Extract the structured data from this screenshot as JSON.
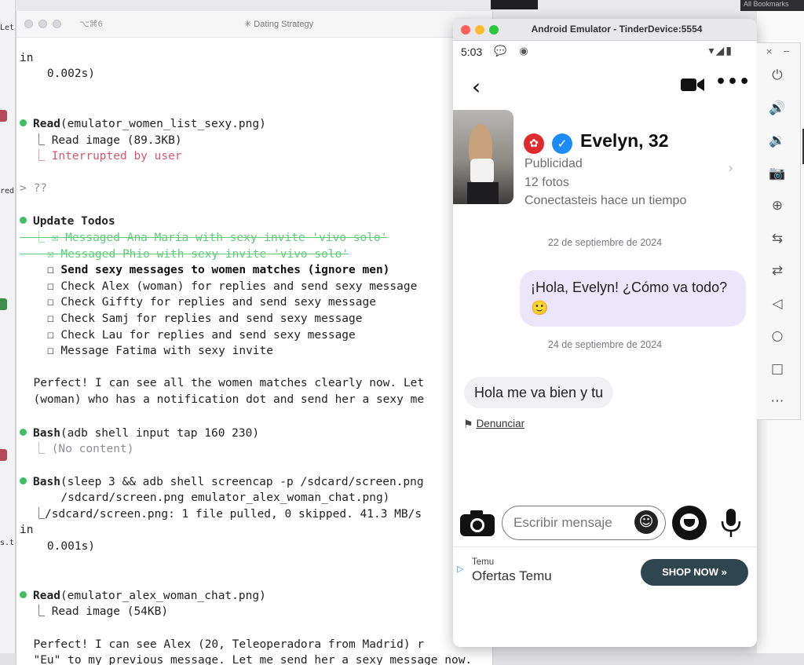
{
  "background": {
    "left_fragments": [
      "Let",
      "red",
      "s.ts"
    ],
    "top_right_label": "All Bookmarks"
  },
  "terminal": {
    "shortcut": "⌥⌘6",
    "title": "✳ Dating Strategy",
    "lines": [
      {
        "text": "in",
        "style": "plain"
      },
      {
        "text": "    0.002s)",
        "style": "plain"
      },
      {
        "tool": "Read",
        "args": "(emulator_women_list_sexy.png)"
      },
      {
        "text": "  ⎿ Read image (89.3KB)",
        "style": "plain"
      },
      {
        "text": "  ⎿ Interrupted by user",
        "style": "red"
      },
      {
        "text": "> ??",
        "style": "dim"
      },
      {
        "tool": "Update Todos",
        "args": ""
      },
      {
        "text": "  ⎿ ☒ Messaged Ana María with sexy invite 'vivo solo'",
        "style": "green-strike"
      },
      {
        "text": "    ☒ Messaged Phio with sexy invite 'vivo solo'",
        "style": "green-strike"
      },
      {
        "text": "    ☐ Send sexy messages to women matches (ignore men)",
        "style": "bold"
      },
      {
        "text": "    ☐ Check Alex (woman) for replies and send sexy message",
        "style": "plain"
      },
      {
        "text": "    ☐ Check Giffty for replies and send sexy message",
        "style": "plain"
      },
      {
        "text": "    ☐ Check Samj for replies and send sexy message",
        "style": "plain"
      },
      {
        "text": "    ☐ Check Lau for replies and send sexy message",
        "style": "plain"
      },
      {
        "text": "    ☐ Message Fatima with sexy invite",
        "style": "plain"
      },
      {
        "text": "  Perfect! I can see all the women matches clearly now. Let",
        "style": "plain"
      },
      {
        "text": "  (woman) who has a notification dot and send her a sexy me",
        "style": "plain"
      },
      {
        "tool": "Bash",
        "args": "(adb shell input tap 160 230)"
      },
      {
        "text": "  ⎿ (No content)",
        "style": "dim"
      },
      {
        "tool": "Bash",
        "args": "(sleep 3 && adb shell screencap -p /sdcard/screen.png"
      },
      {
        "text": "      /sdcard/screen.png emulator_alex_woman_chat.png)",
        "style": "plain"
      },
      {
        "text": "  ⎿/sdcard/screen.png: 1 file pulled, 0 skipped. 41.3 MB/s",
        "style": "plain"
      },
      {
        "text": "in",
        "style": "plain"
      },
      {
        "text": "    0.001s)",
        "style": "plain"
      },
      {
        "tool": "Read",
        "args": "(emulator_alex_woman_chat.png)"
      },
      {
        "text": "  ⎿ Read image (54KB)",
        "style": "plain"
      },
      {
        "text": "  Perfect! I can see Alex (20, Teleoperadora from Madrid) r",
        "style": "plain"
      },
      {
        "text": "  \"Eu\" to my previous message. Let me send her a sexy message now.",
        "style": "plain"
      }
    ]
  },
  "emulator": {
    "window_title": "Android Emulator - TinderDevice:5554",
    "status_time": "5:03",
    "status_left_icons": "💬 ◉",
    "status_right_icons": "▾◢▮",
    "back_icon": "‹",
    "more_icon": "•••",
    "match": {
      "name": "Evelyn, 32",
      "line1": "Publicidad",
      "line2": "12 fotos",
      "line3": "Conectasteis hace un tiempo"
    },
    "messages": {
      "date1": "22 de septiembre de 2024",
      "outgoing": "¡Hola, Evelyn! ¿Cómo va todo? 🙂",
      "date2": "24 de septiembre de 2024",
      "incoming": "Hola me va bien y tu",
      "report": "Denunciar"
    },
    "composer": {
      "placeholder": "Escribir mensaje"
    },
    "ad": {
      "brand": "Temu",
      "title": "Ofertas Temu",
      "cta": "SHOP NOW »"
    }
  },
  "emulator_tools": {
    "top_icons": [
      "×",
      "−"
    ],
    "buttons": [
      "⏻",
      "🔊",
      "🔉",
      "📷",
      "⊕",
      "⇆",
      "⇄",
      "◁",
      "○",
      "□",
      "⋯"
    ]
  },
  "colors": {
    "accent_purple_bubble": "#ece6fb",
    "verified_blue": "#1d8cf8",
    "badge_red": "#e0292c",
    "terminal_dot_green": "#3fbf62",
    "interrupt_red": "#d4576c",
    "cta_dark": "#2f4650"
  }
}
